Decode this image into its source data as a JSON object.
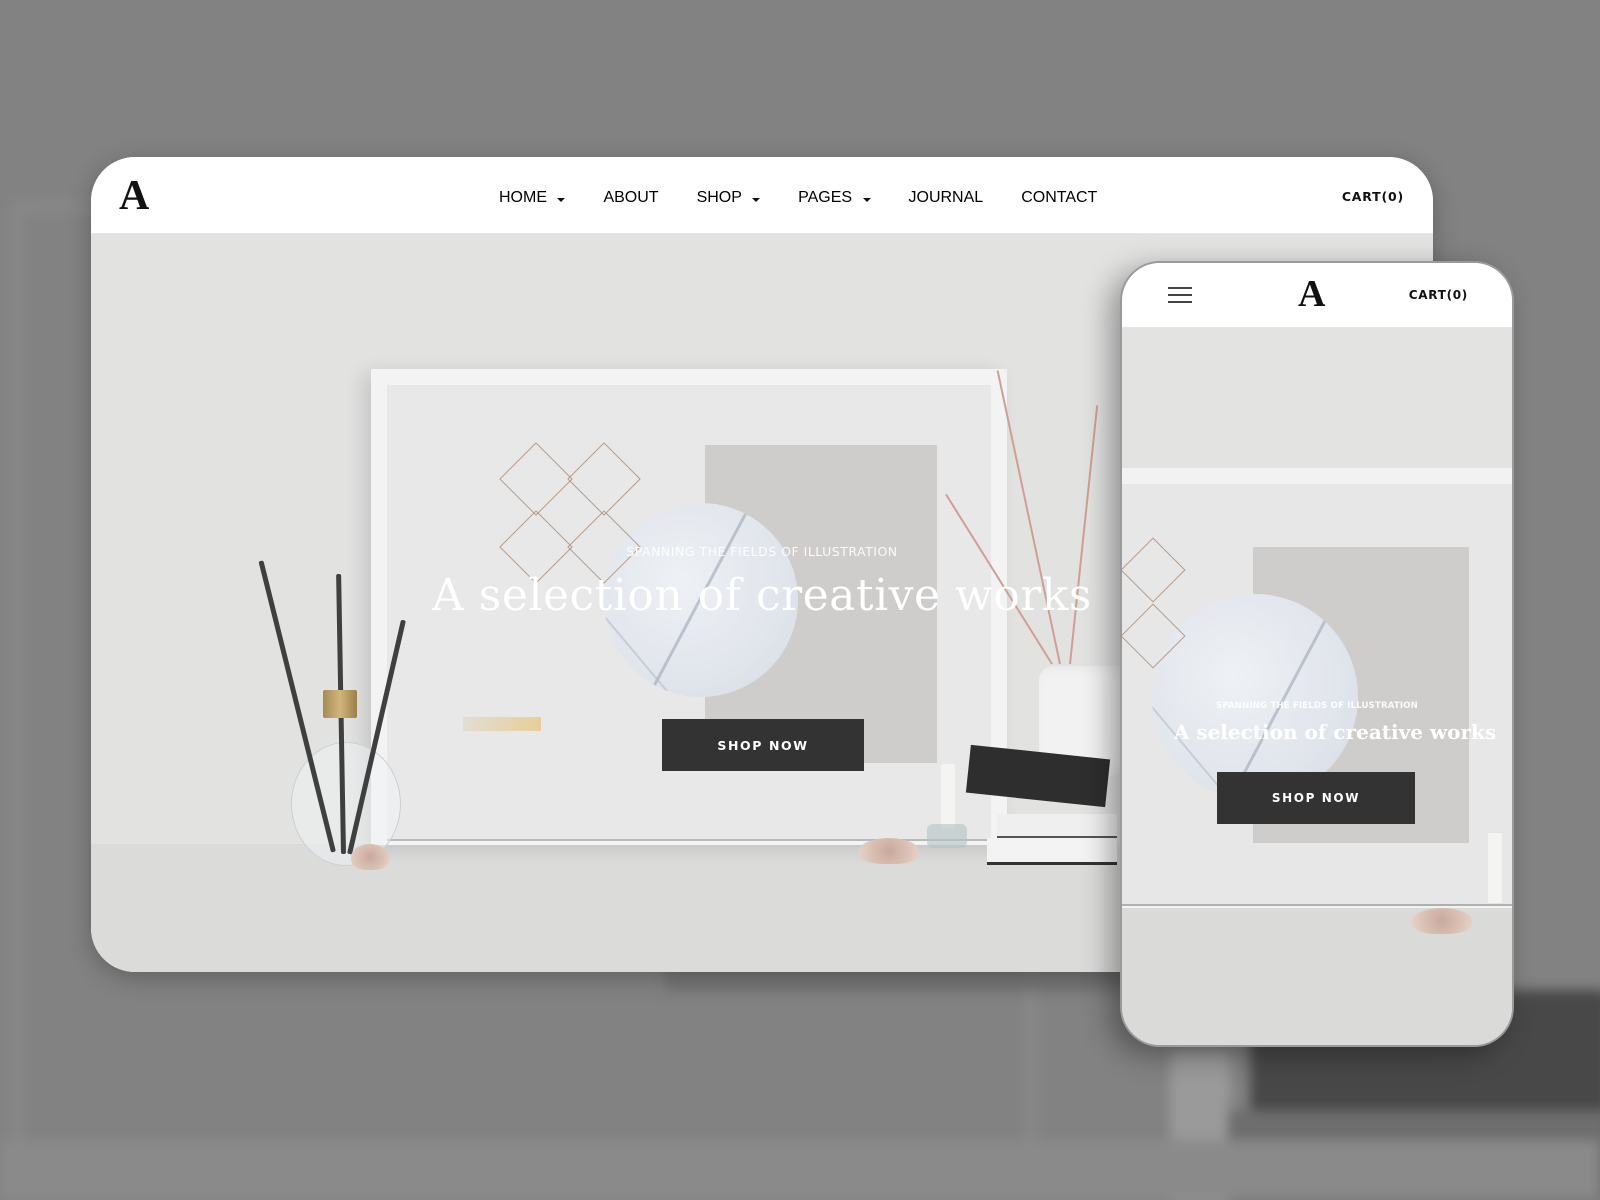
{
  "colors": {
    "backdrop": "#828282",
    "header_bg": "#ffffff",
    "button_bg": "#333333",
    "button_text": "#ffffff",
    "nav_text": "#111111"
  },
  "desktop": {
    "logo": "A",
    "nav": [
      {
        "label": "HOME",
        "has_dropdown": true,
        "icon": "caret-down-icon"
      },
      {
        "label": "ABOUT",
        "has_dropdown": false
      },
      {
        "label": "SHOP",
        "has_dropdown": true,
        "icon": "caret-down-icon"
      },
      {
        "label": "PAGES",
        "has_dropdown": true,
        "icon": "caret-down-icon"
      },
      {
        "label": "JOURNAL",
        "has_dropdown": false
      },
      {
        "label": "CONTACT",
        "has_dropdown": false
      }
    ],
    "cart_label": "CART(0)",
    "hero": {
      "eyebrow": "SPANNING THE FIELDS OF ILLUSTRATION",
      "title": "A selection of creative works",
      "button_label": "SHOP NOW"
    }
  },
  "mobile": {
    "menu_icon": "hamburger-menu-icon",
    "logo": "A",
    "cart_label": "CART(0)",
    "hero": {
      "eyebrow": "SPANNING THE FIELDS OF ILLUSTRATION",
      "title": "A selection of creative works",
      "button_label": "SHOP NOW"
    }
  }
}
